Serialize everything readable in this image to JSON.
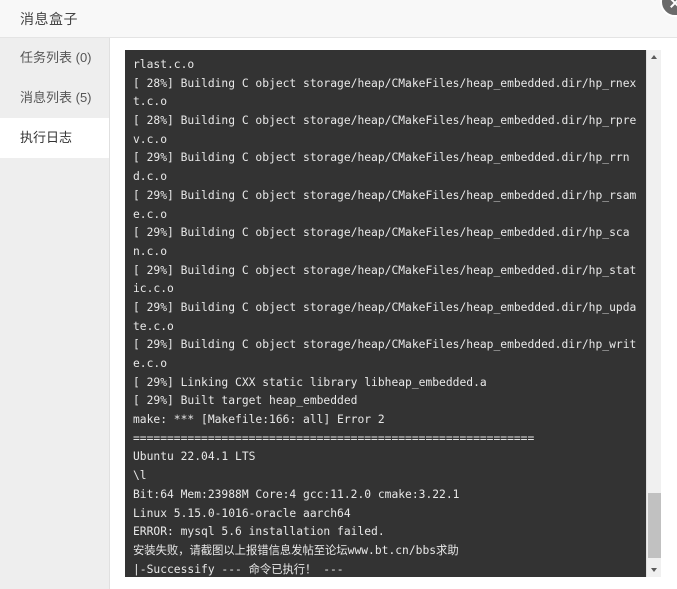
{
  "window": {
    "title": "消息盒子",
    "close_label": "×"
  },
  "sidebar": {
    "items": [
      {
        "label": "任务列表 (0)",
        "name": "任务列表",
        "count": "(0)",
        "active": false
      },
      {
        "label": "消息列表 (5)",
        "name": "消息列表",
        "count": "(5)",
        "active": false
      },
      {
        "label": "执行日志",
        "name": "执行日志",
        "count": "",
        "active": true
      }
    ]
  },
  "log": {
    "content": "rlast.c.o\n[ 28%] Building C object storage/heap/CMakeFiles/heap_embedded.dir/hp_rnext.c.o\n[ 28%] Building C object storage/heap/CMakeFiles/heap_embedded.dir/hp_rprev.c.o\n[ 29%] Building C object storage/heap/CMakeFiles/heap_embedded.dir/hp_rrnd.c.o\n[ 29%] Building C object storage/heap/CMakeFiles/heap_embedded.dir/hp_rsame.c.o\n[ 29%] Building C object storage/heap/CMakeFiles/heap_embedded.dir/hp_scan.c.o\n[ 29%] Building C object storage/heap/CMakeFiles/heap_embedded.dir/hp_static.c.o\n[ 29%] Building C object storage/heap/CMakeFiles/heap_embedded.dir/hp_update.c.o\n[ 29%] Building C object storage/heap/CMakeFiles/heap_embedded.dir/hp_write.c.o\n[ 29%] Linking CXX static library libheap_embedded.a\n[ 29%] Built target heap_embedded\nmake: *** [Makefile:166: all] Error 2\n===========================================================\nUbuntu 22.04.1 LTS\n\\l\nBit:64 Mem:23988M Core:4 gcc:11.2.0 cmake:3.22.1\nLinux 5.15.0-1016-oracle aarch64\nERROR: mysql 5.6 installation failed.\n安装失败，请截图以上报错信息发帖至论坛www.bt.cn/bbs求助\n|-Successify --- 命令已执行！ ---",
    "scroll": {
      "up_arrow": "▲",
      "down_arrow": "▼"
    }
  },
  "colors": {
    "panel_bg": "#333333",
    "log_text": "#e8e8e8",
    "sidebar_bg": "#eeeeee",
    "header_bg": "#f8f8f8",
    "scroll_thumb": "#c1c1c1"
  }
}
